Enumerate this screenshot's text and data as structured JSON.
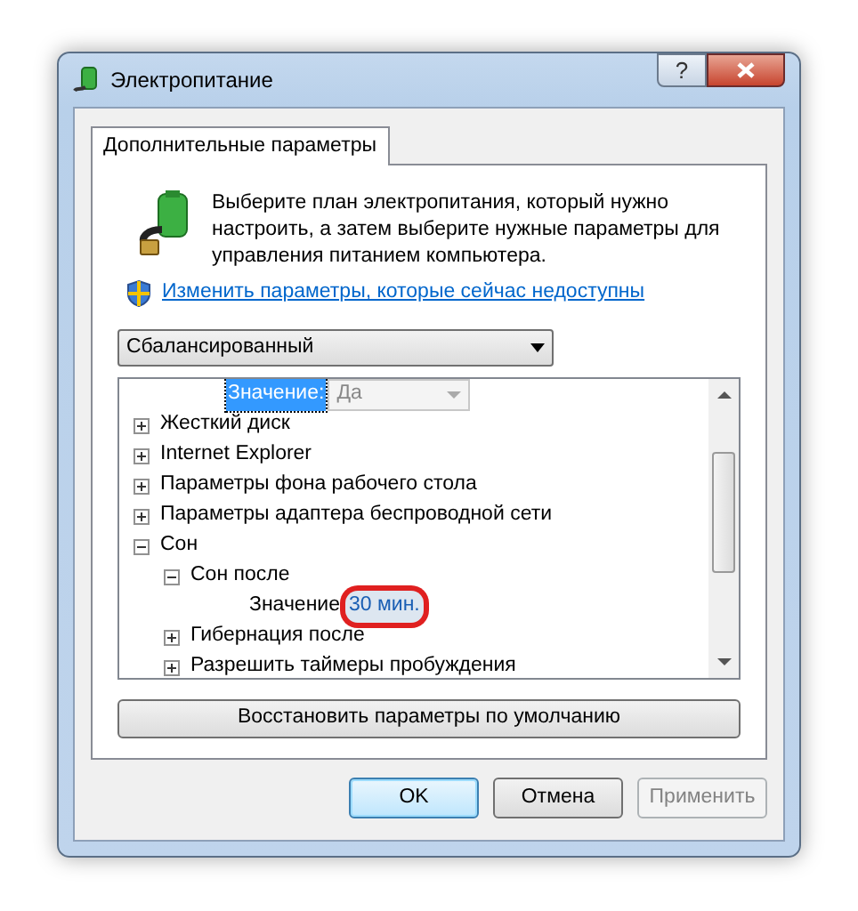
{
  "window": {
    "title": "Электропитание"
  },
  "tabs": [
    {
      "label": "Дополнительные параметры",
      "selected": true
    }
  ],
  "intro": "Выберите план электропитания, который нужно настроить, а затем выберите нужные параметры для управления питанием компьютера.",
  "link": "Изменить параметры, которые сейчас недоступны",
  "plan_select": {
    "value": "Сбалансированный"
  },
  "tree": [
    {
      "kind": "value",
      "label": "Значение:",
      "value": "Да",
      "selected": true
    },
    {
      "kind": "node",
      "label": "Жесткий диск",
      "expanded": false
    },
    {
      "kind": "node",
      "label": "Internet Explorer",
      "expanded": false
    },
    {
      "kind": "node",
      "label": "Параметры фона рабочего стола",
      "expanded": false
    },
    {
      "kind": "node",
      "label": "Параметры адаптера беспроводной сети",
      "expanded": false
    },
    {
      "kind": "node",
      "label": "Сон",
      "expanded": true,
      "children": [
        {
          "kind": "node",
          "label": "Сон после",
          "expanded": true,
          "children": [
            {
              "kind": "value",
              "label": "Значение",
              "value": "30 мин.",
              "selected": false,
              "highlighted": true
            }
          ]
        },
        {
          "kind": "node",
          "label": "Гибернация после",
          "expanded": false
        },
        {
          "kind": "node",
          "label": "Разрешить таймеры пробуждения",
          "expanded": false
        }
      ]
    }
  ],
  "help_button": "?",
  "restore_button": "Восстановить параметры по умолчанию",
  "buttons": [
    {
      "label": "OK",
      "default": true,
      "disabled": false
    },
    {
      "label": "Отмена",
      "default": false,
      "disabled": false
    },
    {
      "label": "Применить",
      "default": false,
      "disabled": true
    }
  ]
}
